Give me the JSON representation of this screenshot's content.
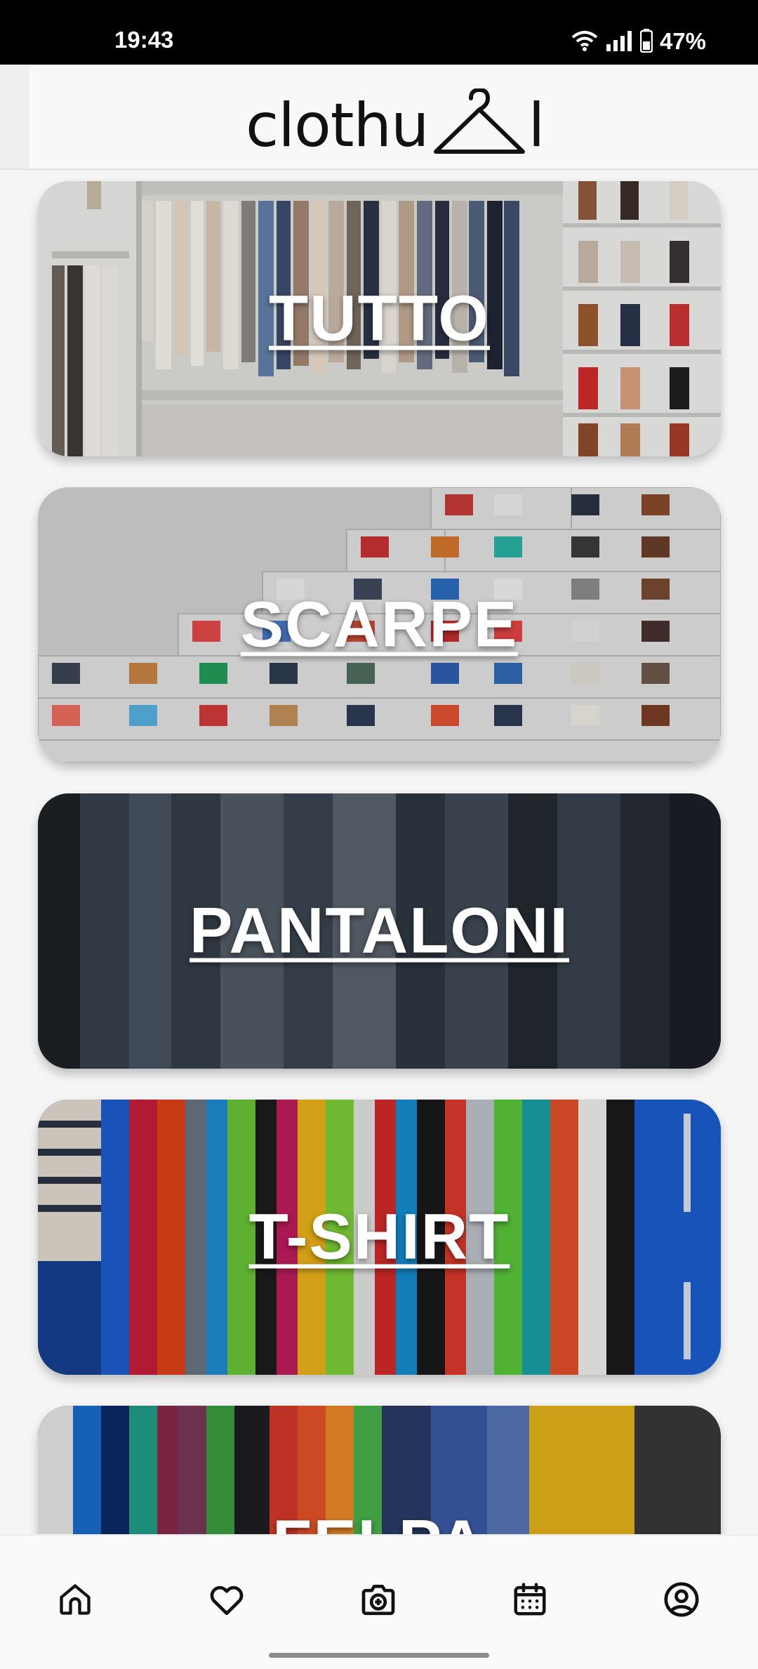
{
  "status_bar": {
    "time": "19:43",
    "battery": "47%",
    "icons": [
      "wifi-icon",
      "signal-icon",
      "battery-icon"
    ]
  },
  "header": {
    "brand": "clothu",
    "brand_tail": "l",
    "logo_icon": "hanger-icon"
  },
  "categories": [
    {
      "label": "TUTTO"
    },
    {
      "label": "SCARPE"
    },
    {
      "label": "PANTALONI"
    },
    {
      "label": "T-SHIRT"
    },
    {
      "label": "FELPA"
    }
  ],
  "bottom_nav": {
    "items": [
      "home-icon",
      "heart-icon",
      "camera-add-icon",
      "calendar-icon",
      "profile-icon"
    ]
  },
  "colors": {
    "status_bar": "#000000",
    "background": "#f5f5f5",
    "icon_stroke": "#111111"
  }
}
